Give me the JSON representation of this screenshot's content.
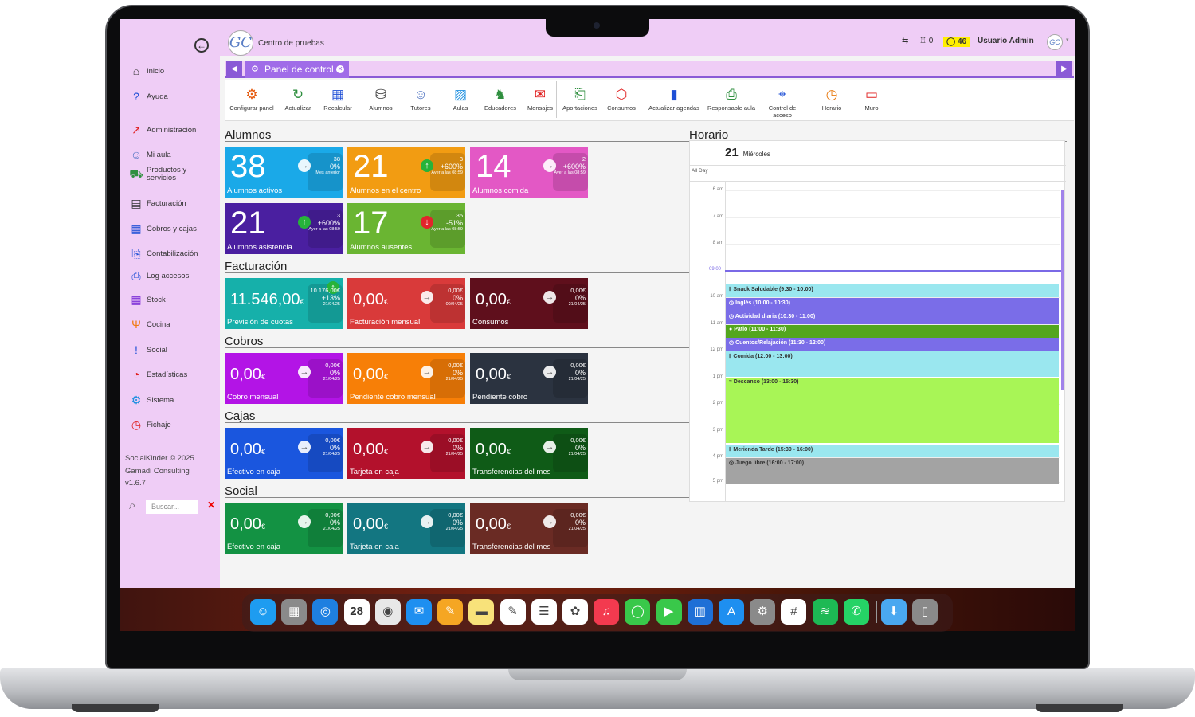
{
  "header": {
    "center_name": "Centro de pruebas",
    "logo_text": "GC",
    "notif_count": "0",
    "messages_count": "46",
    "user": "Usuario Admin"
  },
  "sidebar": {
    "items": [
      {
        "label": "Inicio",
        "icon": "home-icon"
      },
      {
        "label": "Ayuda",
        "icon": "help-icon"
      },
      {
        "label": "Administración",
        "icon": "admin-icon"
      },
      {
        "label": "Mi aula",
        "icon": "classroom-icon"
      },
      {
        "label": "Productos y servicios",
        "icon": "products-icon"
      },
      {
        "label": "Facturación",
        "icon": "invoice-icon"
      },
      {
        "label": "Cobros y cajas",
        "icon": "cash-register-icon"
      },
      {
        "label": "Contabilización",
        "icon": "accounting-icon"
      },
      {
        "label": "Log accesos",
        "icon": "log-icon"
      },
      {
        "label": "Stock",
        "icon": "stock-icon"
      },
      {
        "label": "Cocina",
        "icon": "kitchen-icon"
      },
      {
        "label": "Social",
        "icon": "social-icon"
      },
      {
        "label": "Estadísticas",
        "icon": "stats-icon"
      },
      {
        "label": "Sistema",
        "icon": "gear-icon"
      },
      {
        "label": "Fichaje",
        "icon": "clock-icon"
      }
    ],
    "footer": [
      "SocialKinder © 2025",
      "Gamadi Consulting",
      "v1.6.7"
    ],
    "search_placeholder": "Buscar..."
  },
  "tabs": [
    {
      "label": "Panel de control"
    }
  ],
  "toolbar": [
    "Configurar panel",
    "Actualizar",
    "Recalcular",
    "Alumnos",
    "Tutores",
    "Aulas",
    "Educadores",
    "Mensajes",
    "Aportaciones",
    "Consumos",
    "Actualizar agendas",
    "Responsable aula",
    "Control de acceso",
    "Horario",
    "Muro"
  ],
  "sections": {
    "alumnos": "Alumnos",
    "facturacion": "Facturación",
    "cobros": "Cobros",
    "cajas": "Cajas",
    "social": "Social",
    "horario": "Horario"
  },
  "tiles": {
    "alumnos": [
      {
        "value": "38",
        "label": "Alumnos activos",
        "stat": [
          "38",
          "0%",
          "Mes anterior"
        ],
        "color": "#1aa9e8"
      },
      {
        "value": "21",
        "label": "Alumnos en el centro",
        "stat": [
          "3",
          "+600%",
          "Ayer a las 08:59"
        ],
        "color": "#f29c12"
      },
      {
        "value": "14",
        "label": "Alumnos comida",
        "stat": [
          "2",
          "+600%",
          "Ayer a las 08:59"
        ],
        "color": "#e358c5"
      },
      {
        "value": "21",
        "label": "Alumnos asistencia",
        "stat": [
          "3",
          "+600%",
          "Ayer a las 08:59"
        ],
        "color": "#4a1fa0"
      },
      {
        "value": "17",
        "label": "Alumnos ausentes",
        "stat": [
          "35",
          "-51%",
          "Ayer a las 08:59"
        ],
        "color": "#6ab532"
      }
    ],
    "facturacion": [
      {
        "value": "11.546,00",
        "currency": "€",
        "label": "Previsión de cuotas",
        "stat": [
          "10.176,00€",
          "+13%",
          "21/04/25"
        ],
        "color": "#16b0aa"
      },
      {
        "value": "0,00",
        "currency": "€",
        "label": "Facturación mensual",
        "stat": [
          "0,00€",
          "0%",
          "00/04/25"
        ],
        "color": "#d93a3a"
      },
      {
        "value": "0,00",
        "currency": "€",
        "label": "Consumos",
        "stat": [
          "0,00€",
          "0%",
          "21/04/25"
        ],
        "color": "#5f0f1c"
      }
    ],
    "cobros": [
      {
        "value": "0,00",
        "currency": "€",
        "label": "Cobro mensual",
        "stat": [
          "0,00€",
          "0%",
          "21/04/25"
        ],
        "color": "#b314e6"
      },
      {
        "value": "0,00",
        "currency": "€",
        "label": "Pendiente cobro mensual",
        "stat": [
          "0,00€",
          "0%",
          "21/04/25"
        ],
        "color": "#f77f07"
      },
      {
        "value": "0,00",
        "currency": "€",
        "label": "Pendiente cobro",
        "stat": [
          "0,00€",
          "0%",
          "21/04/25"
        ],
        "color": "#2b3340"
      }
    ],
    "cajas": [
      {
        "value": "0,00",
        "currency": "€",
        "label": "Efectivo en caja",
        "stat": [
          "0,00€",
          "0%",
          "21/04/25"
        ],
        "color": "#1a56de"
      },
      {
        "value": "0,00",
        "currency": "€",
        "label": "Tarjeta en caja",
        "stat": [
          "0,00€",
          "0%",
          "21/04/25"
        ],
        "color": "#b3112c"
      },
      {
        "value": "0,00",
        "currency": "€",
        "label": "Transferencias del mes",
        "stat": [
          "0,00€",
          "0%",
          "21/04/25"
        ],
        "color": "#0f5b17"
      }
    ],
    "social": [
      {
        "value": "0,00",
        "currency": "€",
        "label": "Efectivo en caja",
        "stat": [
          "0,00€",
          "0%",
          "21/04/25"
        ],
        "color": "#139243"
      },
      {
        "value": "0,00",
        "currency": "€",
        "label": "Tarjeta en caja",
        "stat": [
          "0,00€",
          "0%",
          "21/04/25"
        ],
        "color": "#137681"
      },
      {
        "value": "0,00",
        "currency": "€",
        "label": "Transferencias del mes",
        "stat": [
          "0,00€",
          "0%",
          "21/04/25"
        ],
        "color": "#6a2b24"
      }
    ]
  },
  "calendar": {
    "day": "21",
    "weekday": "Miércoles",
    "allday": "All Day",
    "hours": [
      "6 am",
      "7 am",
      "8 am",
      "10 am",
      "11 am",
      "12 pm",
      "1 pm",
      "2 pm",
      "3 pm",
      "4 pm",
      "5 pm"
    ],
    "now_label": "09:00",
    "events": [
      {
        "label": "Snack Saludable (9:30 - 10:00)",
        "color": "#9ae7ef"
      },
      {
        "label": "Inglés (10:00 - 10:30)",
        "color": "#7a6de8"
      },
      {
        "label": "Actividad diaria (10:30 - 11:00)",
        "color": "#7a6de8"
      },
      {
        "label": "Patio (11:00 - 11:30)",
        "color": "#53a61e"
      },
      {
        "label": "Cuentos/Relajación (11:30 - 12:00)",
        "color": "#7a6de8"
      },
      {
        "label": "Comida (12:00 - 13:00)",
        "color": "#9ae7ef"
      },
      {
        "label": "Descanso (13:00 - 15:30)",
        "color": "#a8f556"
      },
      {
        "label": "Merienda Tarde (15:30 - 16:00)",
        "color": "#9ae7ef"
      },
      {
        "label": "Juego libre (16:00 - 17:00)",
        "color": "#a3a3a3"
      }
    ]
  },
  "dock": {
    "apps": [
      "finder",
      "launchpad",
      "safari",
      "calendar",
      "chrome",
      "mail",
      "pages",
      "notes",
      "freeform",
      "reminders",
      "photos",
      "music",
      "messages",
      "facetime",
      "trello",
      "app-store",
      "settings",
      "slack",
      "spotify",
      "whatsapp",
      "downloads",
      "trash"
    ],
    "calendar_day": "28"
  }
}
